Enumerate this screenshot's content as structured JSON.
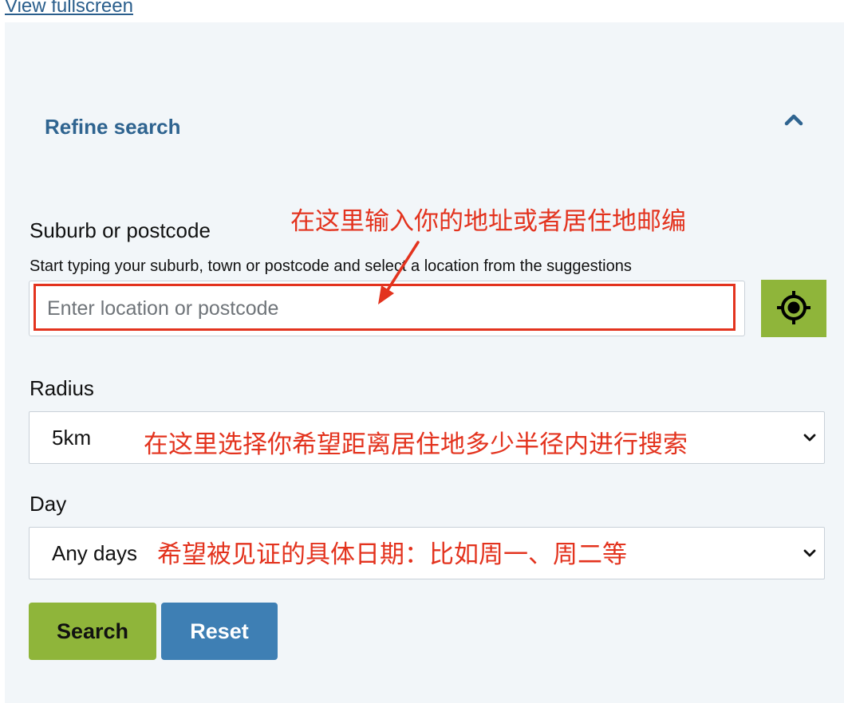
{
  "top_link": "View fullscreen",
  "refine": {
    "title": "Refine search",
    "collapse_icon": "chevron-up-icon"
  },
  "location": {
    "label": "Suburb or postcode",
    "hint": "Start typing your suburb, town or postcode and select a location from the suggestions",
    "placeholder": "Enter location or postcode",
    "value": "",
    "locate_icon": "crosshair-icon",
    "annotation": "在这里输入你的地址或者居住地邮编"
  },
  "radius": {
    "label": "Radius",
    "value": "5km",
    "annotation": "在这里选择你希望距离居住地多少半径内进行搜索"
  },
  "day": {
    "label": "Day",
    "value": "Any days",
    "annotation": "希望被见证的具体日期：比如周一、周二等"
  },
  "buttons": {
    "search": "Search",
    "reset": "Reset"
  },
  "colors": {
    "accent_green": "#8fb53a",
    "accent_blue": "#3e7fb4",
    "title_blue": "#2f6490",
    "annotation_red": "#e3331e",
    "panel_bg": "#f2f6f9"
  }
}
